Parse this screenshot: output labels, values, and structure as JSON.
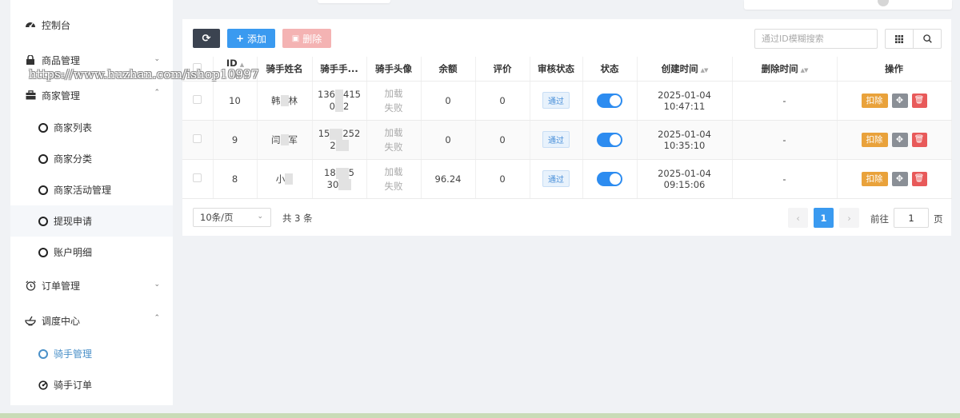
{
  "colors": {
    "primary": "#3a9af0",
    "dark": "#3b4350",
    "danger_soft": "#f4b3b3",
    "active_menu": "#4a90c8",
    "deduct": "#e9a23b",
    "trash": "#e85a5a"
  },
  "watermark": "https://www.huzhan.com/ishop10997",
  "sidebar": {
    "dashboard": {
      "label": "控制台",
      "icon": "dashboard-icon"
    },
    "goods": {
      "label": "商品管理",
      "icon": "lock-icon"
    },
    "merchant": {
      "label": "商家管理",
      "icon": "briefcase-icon"
    },
    "merchant_sub": [
      {
        "label": "商家列表"
      },
      {
        "label": "商家分类"
      },
      {
        "label": "商家活动管理"
      },
      {
        "label": "提现申请"
      },
      {
        "label": "账户明细"
      }
    ],
    "orders": {
      "label": "订单管理",
      "icon": "alarm-clock-icon"
    },
    "dispatch": {
      "label": "调度中心",
      "icon": "bowl-icon"
    },
    "dispatch_sub": [
      {
        "label": "骑手管理",
        "active": true
      },
      {
        "label": "骑手订单"
      }
    ]
  },
  "toolbar": {
    "refresh_icon": "refresh-icon",
    "add_label": "添加",
    "delete_label": "删除",
    "search_placeholder": "通过ID模糊搜索",
    "grid_icon": "grid-icon",
    "search_icon": "search-icon"
  },
  "table": {
    "headers": {
      "id": "ID",
      "name": "骑手姓名",
      "phone": "骑手手...",
      "avatar": "骑手头像",
      "balance": "余额",
      "rating": "评价",
      "audit": "审核状态",
      "status": "状态",
      "created": "创建时间",
      "deleted": "删除时间",
      "ops": "操作"
    },
    "rows": [
      {
        "id": "10",
        "name_a": "韩",
        "name_b": "林",
        "phone_a": "136",
        "phone_b": "415",
        "phone_c": "0",
        "phone_d": "2",
        "avatar_a": "加载",
        "avatar_b": "失败",
        "balance": "0",
        "rating": "0",
        "audit": "通过",
        "status_on": true,
        "created": "2025-01-04 10:47:11",
        "deleted": "-",
        "deduct": "扣除"
      },
      {
        "id": "9",
        "name_a": "闫",
        "name_b": "军",
        "phone_a": "15",
        "phone_b": "252",
        "phone_c": "2",
        "phone_d": "",
        "avatar_a": "加载",
        "avatar_b": "失败",
        "balance": "0",
        "rating": "0",
        "audit": "通过",
        "status_on": true,
        "created": "2025-01-04 10:35:10",
        "deleted": "-",
        "deduct": "扣除"
      },
      {
        "id": "8",
        "name_a": "小",
        "name_b": "",
        "phone_a": "18",
        "phone_b": "5",
        "phone_c": "30",
        "phone_d": "",
        "avatar_a": "加载",
        "avatar_b": "失败",
        "balance": "96.24",
        "rating": "0",
        "audit": "通过",
        "status_on": true,
        "created": "2025-01-04 09:15:06",
        "deleted": "-",
        "deduct": "扣除"
      }
    ]
  },
  "pager": {
    "page_size": "10条/页",
    "total": "共 3 条",
    "current_page": "1",
    "goto_label": "前往",
    "goto_value": "1",
    "goto_unit": "页"
  }
}
